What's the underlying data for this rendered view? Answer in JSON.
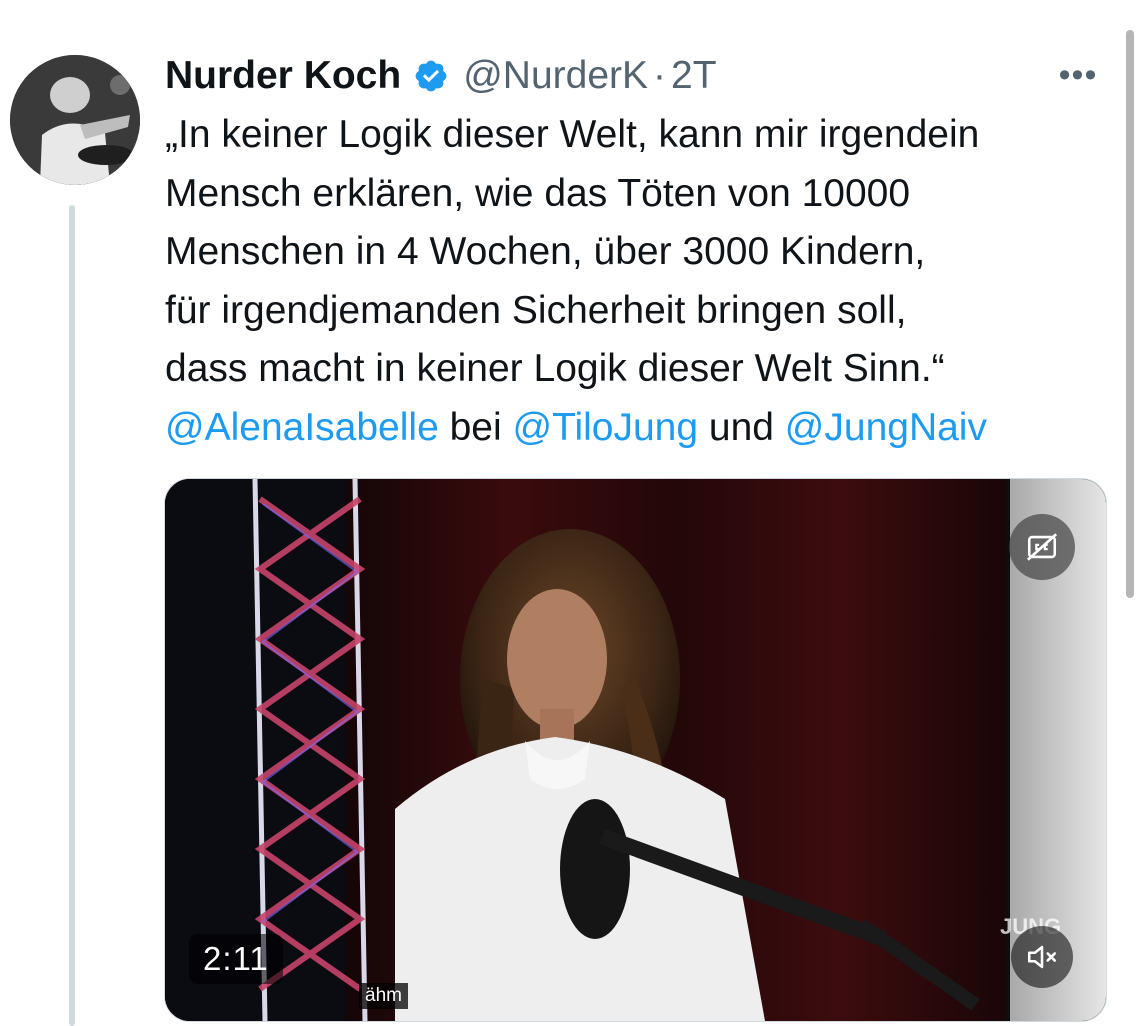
{
  "author": {
    "name": "Nurder Koch",
    "handle": "@NurderK",
    "separator": "·",
    "time": "2T",
    "verified": true
  },
  "menu": {
    "more_label": "•••"
  },
  "tweet": {
    "lines": [
      "„In keiner Logik dieser Welt, kann mir irgendein",
      "Mensch erklären, wie das Töten von 10000",
      "Menschen in 4 Wochen, über 3000 Kindern,",
      "für irgendjemanden Sicherheit bringen soll,",
      "dass macht in keiner Logik dieser Welt Sinn.“"
    ],
    "mention1": "@AlenaIsabelle",
    "joiner1": " bei ",
    "mention2": "@TiloJung",
    "joiner2": " und ",
    "mention3": "@JungNaiv"
  },
  "video": {
    "duration": "2:11",
    "subtitle": "ähm",
    "watermark": "JUNG",
    "icons": {
      "captions": "closed-captions-off-icon",
      "volume": "volume-muted-icon"
    }
  },
  "colors": {
    "link": "#1d9bf0",
    "verified": "#1d9bf0",
    "secondary_text": "#536471",
    "thread_line": "#cfd9de"
  }
}
